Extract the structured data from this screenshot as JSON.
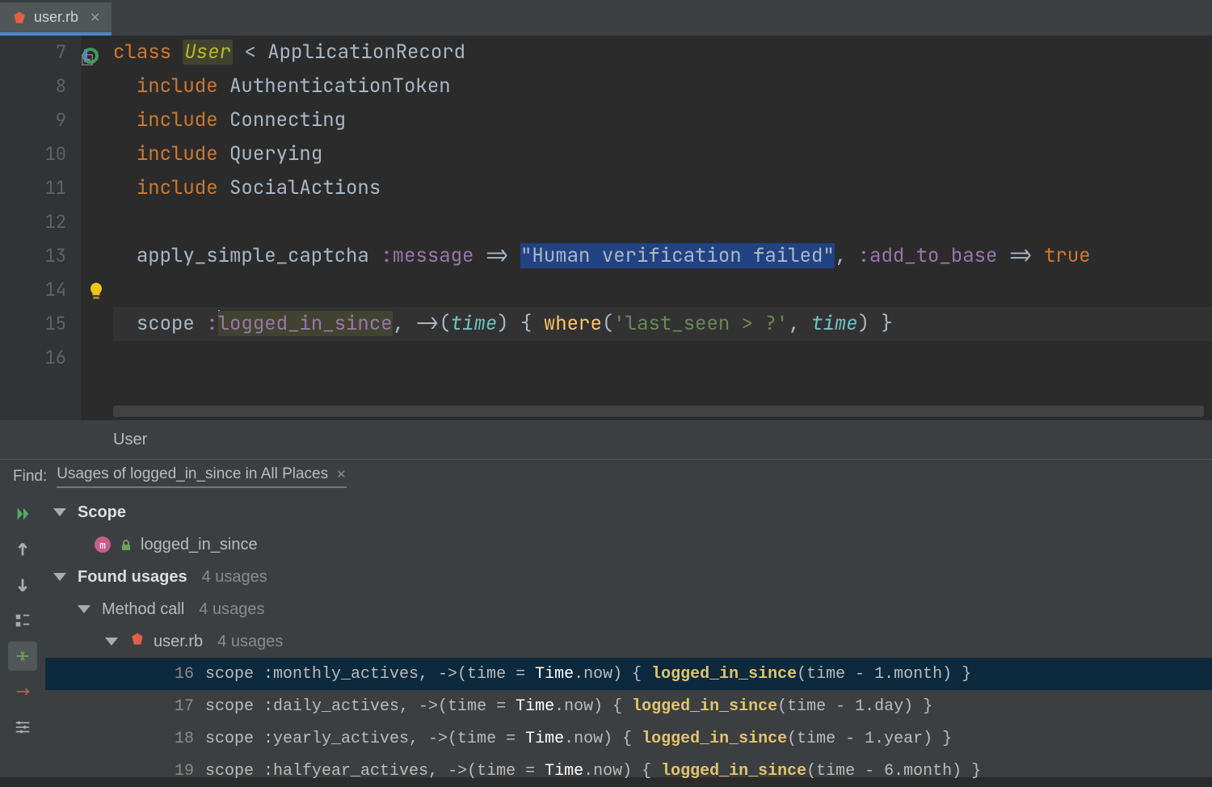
{
  "tab": {
    "filename": "user.rb"
  },
  "gutter": {
    "lines": [
      7,
      8,
      9,
      10,
      11,
      12,
      13,
      14,
      15,
      16
    ]
  },
  "code": {
    "l7": {
      "kw": "class ",
      "name": "User",
      "lt": " < ",
      "parent": "ApplicationRecord"
    },
    "l8": {
      "kw": "include ",
      "mod": "AuthenticationToken"
    },
    "l9": {
      "kw": "include ",
      "mod": "Connecting"
    },
    "l10": {
      "kw": "include ",
      "mod": "Querying"
    },
    "l11": {
      "kw": "include ",
      "mod": "SocialActions"
    },
    "l13": {
      "call": "apply_simple_captcha ",
      "k1": ":message",
      "arw": " => ",
      "str": "\"Human verification failed\"",
      "c": ", ",
      "k2": ":add_to_base",
      "arw2": " => ",
      "true": "true"
    },
    "l15": {
      "scope": "scope ",
      "colon": ":",
      "sym": "logged_in_since",
      "c": ", ",
      "arrow": "->(",
      "param": "time",
      "rp": ") { ",
      "where": "where",
      "op": "(",
      "sql": "'last_seen > ?'",
      "c2": ", ",
      "param2": "time",
      "cp": ") }"
    }
  },
  "breadcrumb": "User",
  "find": {
    "label": "Find:",
    "tab": "Usages of logged_in_since in All Places",
    "scope_label": "Scope",
    "scope_item": "logged_in_since",
    "found_label": "Found usages",
    "found_count": "4 usages",
    "method_label": "Method call",
    "method_count": "4 usages",
    "file_label": "user.rb",
    "file_count": "4 usages",
    "usages": [
      {
        "ln": "16",
        "pre": "scope ",
        "sym": ":monthly_actives",
        "args": ", ->(time = ",
        "tclass": "Time",
        "tnow": ".now) { ",
        "hl": "logged_in_since",
        "post": "(time - 1.month) }"
      },
      {
        "ln": "17",
        "pre": "scope ",
        "sym": ":daily_actives",
        "args": ", ->(time = ",
        "tclass": "Time",
        "tnow": ".now) { ",
        "hl": "logged_in_since",
        "post": "(time - 1.day) }"
      },
      {
        "ln": "18",
        "pre": "scope ",
        "sym": ":yearly_actives",
        "args": ", ->(time = ",
        "tclass": "Time",
        "tnow": ".now) { ",
        "hl": "logged_in_since",
        "post": "(time - 1.year) }"
      },
      {
        "ln": "19",
        "pre": "scope ",
        "sym": ":halfyear_actives",
        "args": ", ->(time = ",
        "tclass": "Time",
        "tnow": ".now) { ",
        "hl": "logged_in_since",
        "post": "(time - 6.month) }"
      }
    ]
  }
}
